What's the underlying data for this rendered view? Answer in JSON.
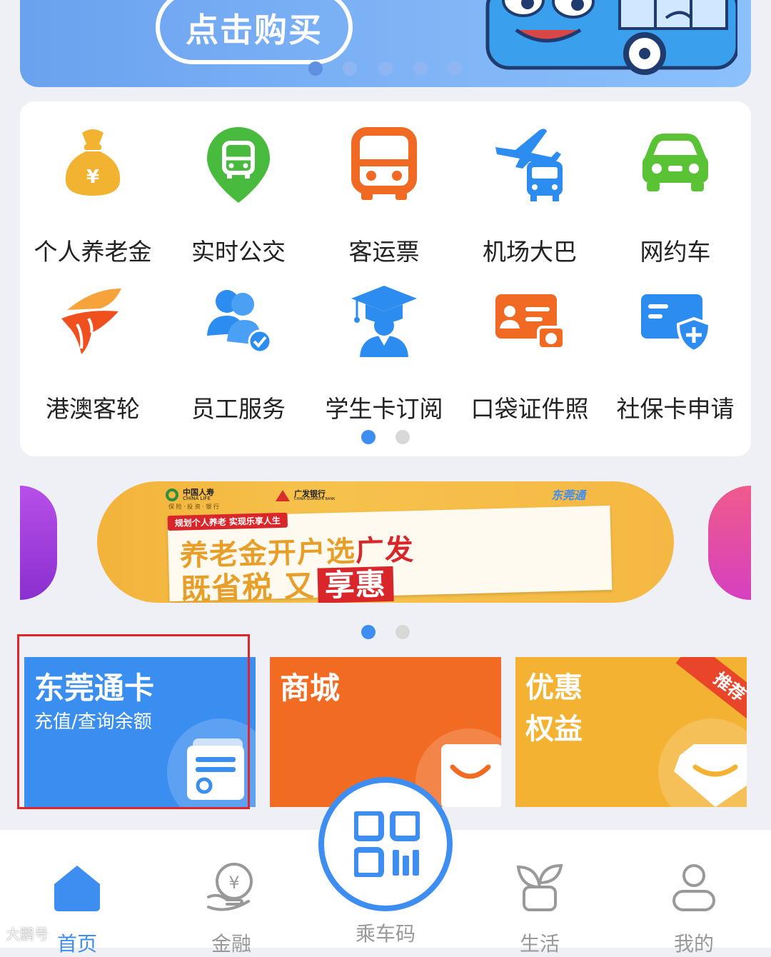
{
  "banner": {
    "buy_label": "点击购买",
    "carousel_active": 1,
    "carousel_count": 5
  },
  "services": {
    "items": [
      {
        "label": "个人养老金",
        "icon": "money-bag-icon",
        "color": "#f2b330"
      },
      {
        "label": "实时公交",
        "icon": "bus-location-pin-icon",
        "color": "#48bb3e"
      },
      {
        "label": "客运票",
        "icon": "coach-bus-icon",
        "color": "#f06a23"
      },
      {
        "label": "机场大巴",
        "icon": "airport-bus-icon",
        "color": "#2d8cf0"
      },
      {
        "label": "网约车",
        "icon": "car-icon",
        "color": "#59c335"
      },
      {
        "label": "港澳客轮",
        "icon": "ferry-sail-icon",
        "color": "#f0501e"
      },
      {
        "label": "员工服务",
        "icon": "staff-verified-icon",
        "color": "#2d8cf0"
      },
      {
        "label": "学生卡订阅",
        "icon": "graduate-icon",
        "color": "#2d8cf0"
      },
      {
        "label": "口袋证件照",
        "icon": "id-photo-icon",
        "color": "#f06a23"
      },
      {
        "label": "社保卡申请",
        "icon": "social-security-card-icon",
        "color": "#2d8cf0"
      }
    ],
    "page_active": 1,
    "page_count": 2
  },
  "promo": {
    "logo1_cn": "中国人寿",
    "logo1_en": "CHINA LIFE",
    "logo1_sub": "保 险 · 投 资 · 银 行",
    "logo2_cn": "广发银行",
    "logo2_en": "CHINA GUANGFA BANK",
    "brand": "东莞通",
    "tag": "规划个人养老 实现乐享人生",
    "line1a": "养老金开户选",
    "line1b": "广发",
    "line2a": "既省税 又",
    "line2b": "享惠",
    "page_active": 1,
    "page_count": 2
  },
  "tiles": {
    "card_title": "东莞通卡",
    "card_sub": "充值/查询余额",
    "mall_title": "商城",
    "benefit_title_1": "优惠",
    "benefit_title_2": "权益",
    "recommend_badge": "推荐",
    "card_color": "#3a8ef0",
    "mall_color": "#f26b22",
    "benefit_color": "#f3b232"
  },
  "nav": {
    "home": "首页",
    "finance": "金融",
    "scan": "乘车码",
    "life": "生活",
    "mine": "我的",
    "active_color": "#3d8ef0"
  },
  "watermark": "大鹏号"
}
